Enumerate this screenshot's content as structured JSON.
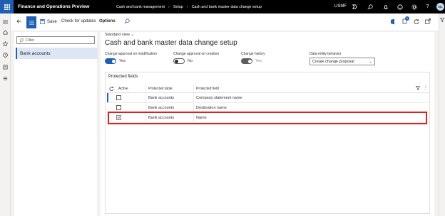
{
  "topbar": {
    "app_title": "Finance and Operations Preview",
    "breadcrumbs": [
      "Cash and bank management",
      "Setup",
      "Cash and bank master data change setup"
    ],
    "company": "USMF",
    "avatar_initials": "ML",
    "icons": [
      "waffle-icon",
      "copilot-icon",
      "search-icon",
      "bell-icon",
      "smiley-icon",
      "gear-icon",
      "help-icon"
    ]
  },
  "actionbar": {
    "save_label": "Save",
    "check_updates_label": "Check for updates",
    "options_label": "Options"
  },
  "list": {
    "filter_placeholder": "Filter",
    "items": [
      "Bank accounts"
    ]
  },
  "main": {
    "view_name": "Standard view",
    "page_title": "Cash and bank master data change setup",
    "fields": {
      "approval_modification": {
        "label": "Change approval on modification",
        "value": "Yes",
        "on": true
      },
      "approval_creation": {
        "label": "Change approval on creation",
        "value": "No",
        "on": false
      },
      "change_history": {
        "label": "Change history",
        "value": "Yes",
        "on": true
      },
      "data_entity": {
        "label": "Data entity behavior",
        "value": "Create change proposal"
      }
    },
    "fasttab_title": "Protected fields",
    "grid": {
      "headers": {
        "active": "Active",
        "table": "Protected table",
        "field": "Protected field"
      },
      "rows": [
        {
          "active": false,
          "table": "Bank accounts",
          "field": "Company statement name"
        },
        {
          "active": false,
          "table": "Bank accounts",
          "field": "Destination name"
        },
        {
          "active": true,
          "table": "Bank accounts",
          "field": "Name"
        }
      ]
    }
  },
  "colors": {
    "brand": "#1f5fb3",
    "highlight": "#e02020",
    "topbar": "#000000"
  }
}
